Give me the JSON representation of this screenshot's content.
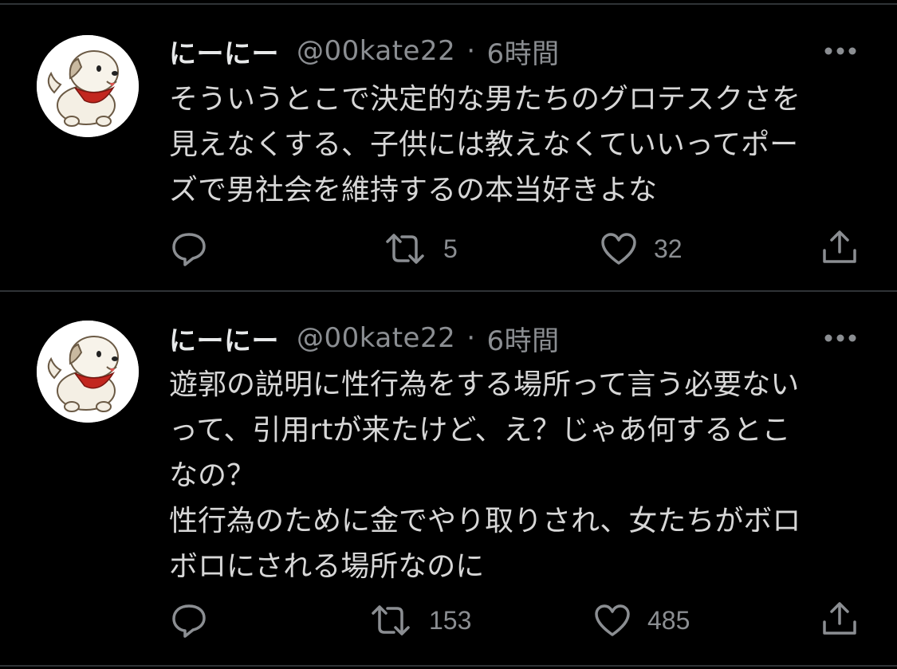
{
  "tweets": [
    {
      "name": "にーにー",
      "handle": "@00kate22",
      "separator": "·",
      "time": "6時間",
      "text": "そういうとこで決定的な男たちのグロテスクさを\n見えなくする、子供には教えなくていいってポー\nズで男社会を維持するの本当好きよな",
      "retweets": "5",
      "likes": "32"
    },
    {
      "name": "にーにー",
      "handle": "@00kate22",
      "separator": "·",
      "time": "6時間",
      "text": "遊郭の説明に性行為をする場所って言う必要ない\nって、引用rtが来たけど、え？じゃあ何するとこ\nなの？\n性行為のために金でやり取りされ、女たちがボロ\nボロにされる場所なのに",
      "retweets": "153",
      "likes": "485"
    }
  ],
  "colors": {
    "background": "#000000",
    "divider": "#2f3336",
    "primary_text": "#e7e9ea",
    "secondary_text": "#8b8e92"
  }
}
